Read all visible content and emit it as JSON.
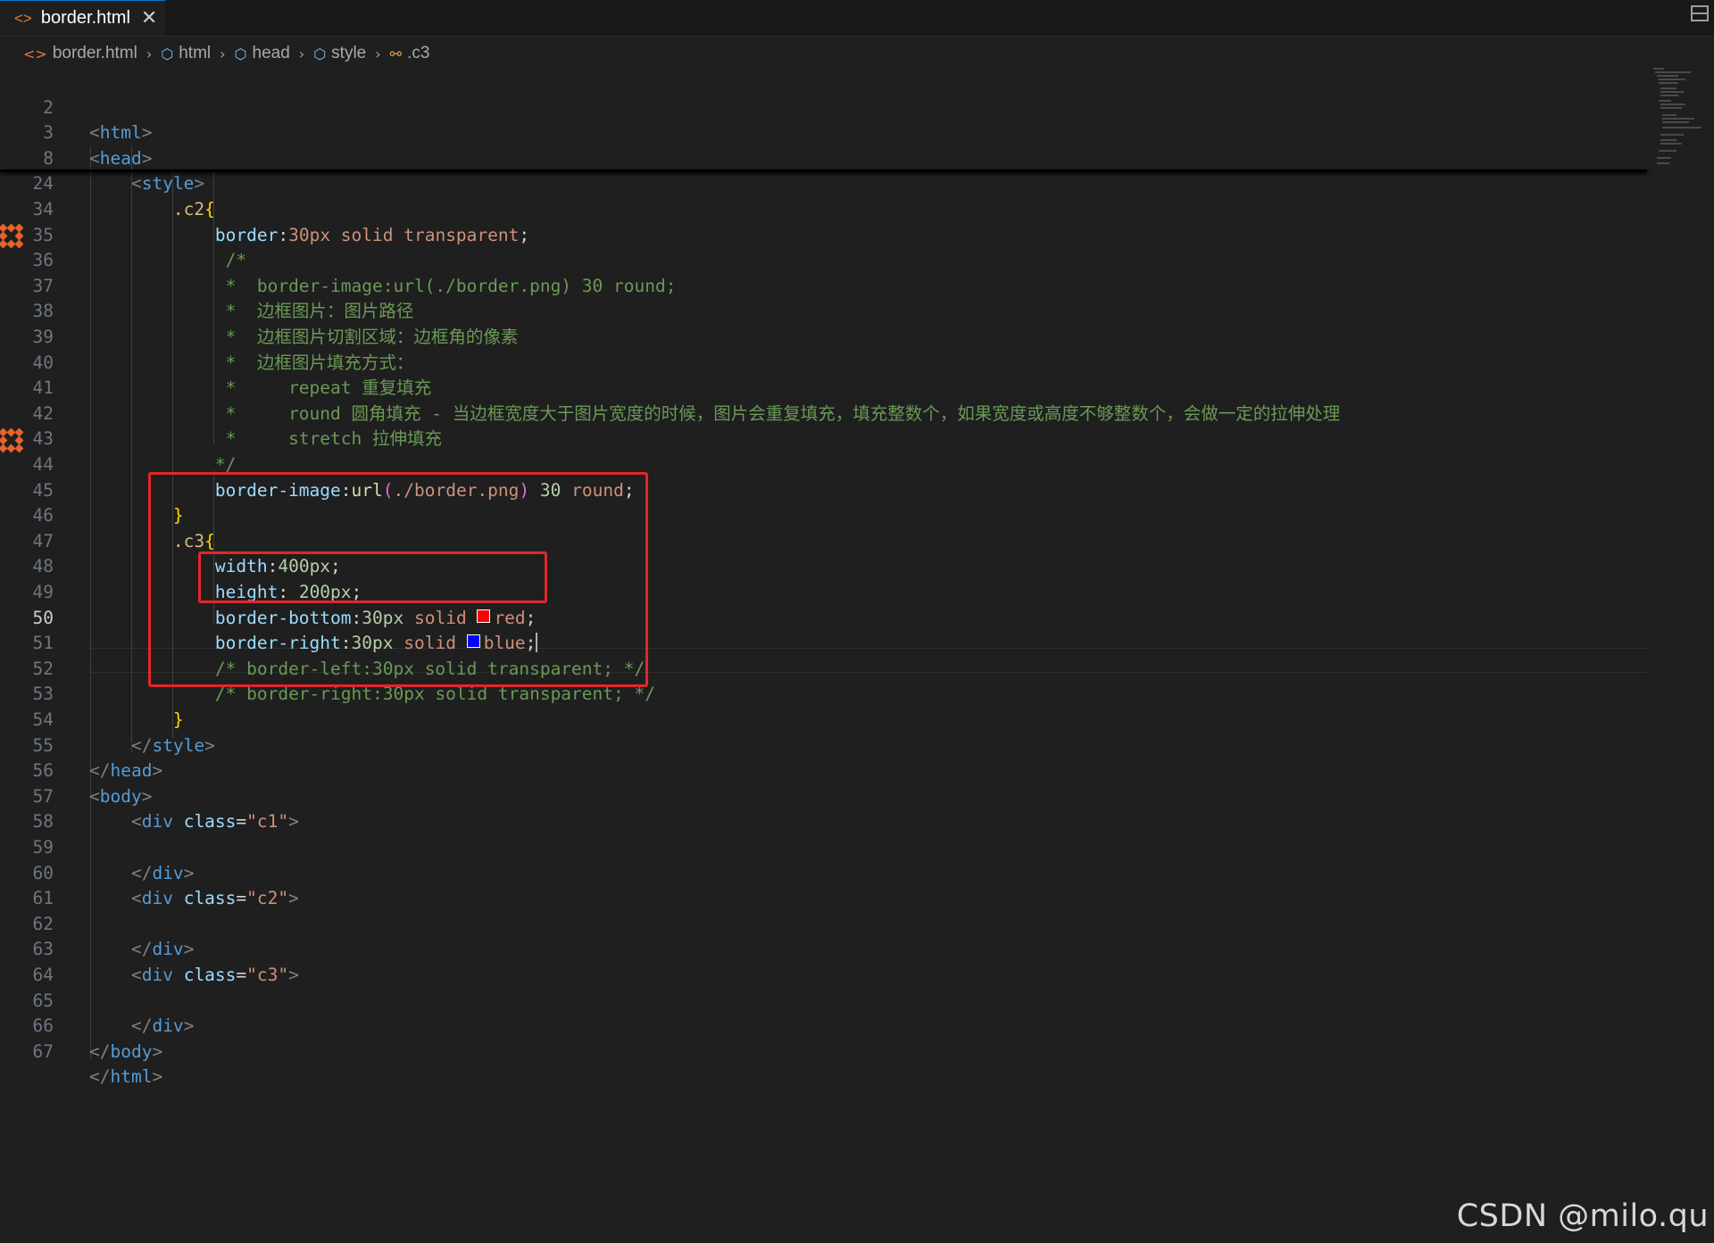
{
  "tab": {
    "title": "border.html",
    "icon": "html-file-icon",
    "close": "✕"
  },
  "breadcrumb": {
    "file": "border.html",
    "items": [
      "html",
      "head",
      "style",
      ".c3"
    ]
  },
  "editor": {
    "active_line": "50",
    "lines": [
      {
        "n": "2"
      },
      {
        "n": "3"
      },
      {
        "n": "8"
      },
      {
        "n": "24"
      },
      {
        "n": "34"
      },
      {
        "n": "35"
      },
      {
        "n": "36"
      },
      {
        "n": "37"
      },
      {
        "n": "38"
      },
      {
        "n": "39"
      },
      {
        "n": "40"
      },
      {
        "n": "41"
      },
      {
        "n": "42"
      },
      {
        "n": "43"
      },
      {
        "n": "44"
      },
      {
        "n": "45"
      },
      {
        "n": "46"
      },
      {
        "n": "47"
      },
      {
        "n": "48"
      },
      {
        "n": "49"
      },
      {
        "n": "50"
      },
      {
        "n": "51"
      },
      {
        "n": "52"
      },
      {
        "n": "53"
      },
      {
        "n": "54"
      },
      {
        "n": "55"
      },
      {
        "n": "56"
      },
      {
        "n": "57"
      },
      {
        "n": "58"
      },
      {
        "n": "59"
      },
      {
        "n": "60"
      },
      {
        "n": "61"
      },
      {
        "n": "62"
      },
      {
        "n": "63"
      },
      {
        "n": "64"
      },
      {
        "n": "65"
      },
      {
        "n": "66"
      },
      {
        "n": "67"
      }
    ],
    "code": {
      "l2_tag": "html",
      "l3_tag": "head",
      "l8_tag": "style",
      "l24_sel": ".c2",
      "l34_prop": "border",
      "l34_val": "30px solid transparent",
      "l35": "/*",
      "l36": "*  border-image:url(./border.png) 30 round;",
      "l37": "*  边框图片：图片路径",
      "l38": "*  边框图片切割区域：边框角的像素",
      "l39": "*  边框图片填充方式：",
      "l40": "*     repeat 重复填充",
      "l41": "*     round 圆角填充 - 当边框宽度大于图片宽度的时候，图片会重复填充，填充整数个，如果宽度或高度不够整数个，会做一定的拉伸处理",
      "l42": "*     stretch 拉伸填充",
      "l43": "*/",
      "l44_prop": "border-image",
      "l44_fn": "url",
      "l44_arg": "./border.png",
      "l44_num": "30",
      "l44_kw": "round",
      "l46_sel": ".c3",
      "l47_prop": "width",
      "l47_val": "400px",
      "l48_prop": "height",
      "l48_val": "200px",
      "l49_prop": "border-bottom",
      "l49_num": "30px",
      "l49_kw": "solid",
      "l49_color": "red",
      "l50_prop": "border-right",
      "l50_num": "30px",
      "l50_kw": "solid",
      "l50_color": "blue",
      "l51": "/* border-left:30px solid transparent; */",
      "l52": "/* border-right:30px solid transparent; */",
      "l54_tag": "style",
      "l55_tag": "head",
      "l56_tag": "body",
      "l57_tag": "div",
      "l57_attr": "class",
      "l57_val": "\"c1\"",
      "l59_tag": "div",
      "l60_tag": "div",
      "l60_attr": "class",
      "l60_val": "\"c2\"",
      "l62_tag": "div",
      "l63_tag": "div",
      "l63_attr": "class",
      "l63_val": "\"c3\"",
      "l65_tag": "div",
      "l66_tag": "body",
      "l67_tag": "html"
    }
  },
  "colors": {
    "swatch_red": "#ff0000",
    "swatch_blue": "#0000ff",
    "highlight_box": "#e3262a"
  },
  "watermark": "CSDN @milo.qu"
}
